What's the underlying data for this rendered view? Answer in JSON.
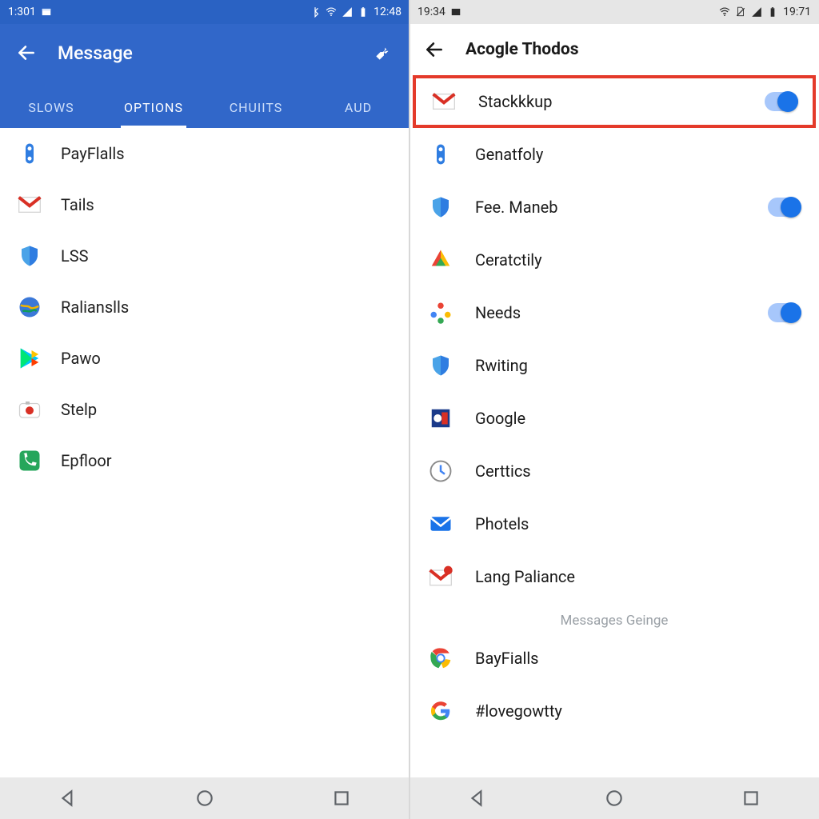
{
  "left": {
    "status": {
      "time_left": "1:301",
      "time_right": "12:48"
    },
    "appbar": {
      "title": "Message"
    },
    "tabs": [
      "SLOWS",
      "OPTIONS",
      "CHUIITS",
      "AUD"
    ],
    "active_tab_index": 1,
    "items": [
      {
        "icon": "blueovals",
        "label": "PayFlalls"
      },
      {
        "icon": "gmail",
        "label": "Tails"
      },
      {
        "icon": "shield",
        "label": "LSS"
      },
      {
        "icon": "globe",
        "label": "Ralianslls"
      },
      {
        "icon": "play",
        "label": "Pawo"
      },
      {
        "icon": "camera",
        "label": "Stelp"
      },
      {
        "icon": "phone",
        "label": "Epfloor"
      }
    ]
  },
  "right": {
    "status": {
      "time_left": "19:34",
      "time_right": "19:71"
    },
    "appbar": {
      "title": "Acogle Thodos"
    },
    "caption": "Messages Geinge",
    "items": [
      {
        "icon": "gmail",
        "label": "Stackkkup",
        "toggle": true,
        "highlight": true
      },
      {
        "icon": "blueovals",
        "label": "Genatfoly"
      },
      {
        "icon": "shield",
        "label": "Fee. Maneb",
        "toggle": true
      },
      {
        "icon": "chrome3",
        "label": "Ceratctily"
      },
      {
        "icon": "colordots",
        "label": "Needs",
        "toggle": true
      },
      {
        "icon": "shield",
        "label": "Rwiting"
      },
      {
        "icon": "flag",
        "label": "Google"
      },
      {
        "icon": "clock",
        "label": "Certtics"
      },
      {
        "icon": "envelope",
        "label": "Photels"
      },
      {
        "icon": "mailbadge",
        "label": "Lang Paliance"
      },
      {
        "icon": "chrome",
        "label": "BayFialls"
      },
      {
        "icon": "gcolor",
        "label": "#lovegowtty"
      }
    ]
  }
}
